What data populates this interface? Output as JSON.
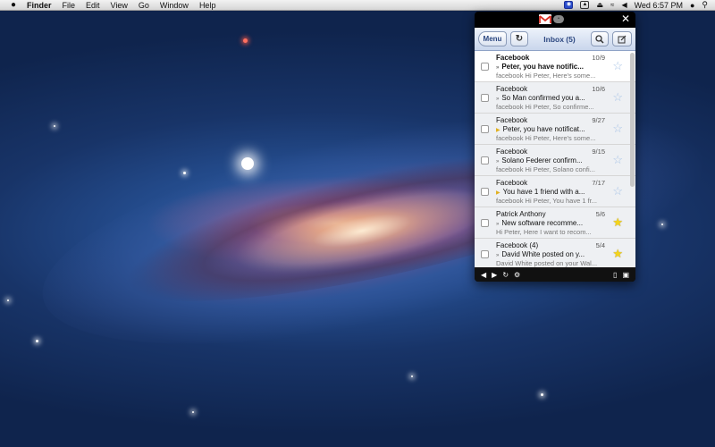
{
  "menubar": {
    "app_name": "Finder",
    "menus": [
      "File",
      "Edit",
      "View",
      "Go",
      "Window",
      "Help"
    ],
    "clock": "Wed 6:57 PM",
    "icons": [
      "apple-icon",
      "screen-sharing-icon",
      "image-capture-icon",
      "eject-icon",
      "wifi-icon",
      "volume-icon",
      "user-icon",
      "spotlight-icon"
    ]
  },
  "panel": {
    "logo_icon": "gmail-logo-icon",
    "toolbar": {
      "menu_label": "Menu",
      "title": "Inbox (5)"
    },
    "emails": [
      {
        "sender": "Facebook",
        "date": "10/9",
        "subject": "Peter, you have notific...",
        "snippet": "facebook Hi Peter, Here's some...",
        "unread": true,
        "important": false,
        "starred": false
      },
      {
        "sender": "Facebook",
        "date": "10/6",
        "subject": "So Man confirmed you a...",
        "snippet": "facebook Hi Peter, So confirme...",
        "unread": false,
        "important": false,
        "starred": false
      },
      {
        "sender": "Facebook",
        "date": "9/27",
        "subject": "Peter, you have notificat...",
        "snippet": "facebook Hi Peter, Here's some...",
        "unread": false,
        "important": true,
        "starred": false
      },
      {
        "sender": "Facebook",
        "date": "9/15",
        "subject": "Solano Federer confirm...",
        "snippet": "facebook Hi Peter, Solano confi...",
        "unread": false,
        "important": false,
        "starred": false
      },
      {
        "sender": "Facebook",
        "date": "7/17",
        "subject": "You have 1 friend with a...",
        "snippet": "facebook Hi Peter, You have 1 fr...",
        "unread": false,
        "important": true,
        "starred": false
      },
      {
        "sender": "Patrick Anthony",
        "date": "5/6",
        "subject": "New software recomme...",
        "snippet": "Hi Peter, Here I want to recom...",
        "unread": false,
        "important": false,
        "starred": true
      },
      {
        "sender": "Facebook (4)",
        "date": "5/4",
        "subject": "David White posted on y...",
        "snippet": "David White posted on your Wal...",
        "unread": false,
        "important": false,
        "starred": true
      }
    ]
  }
}
